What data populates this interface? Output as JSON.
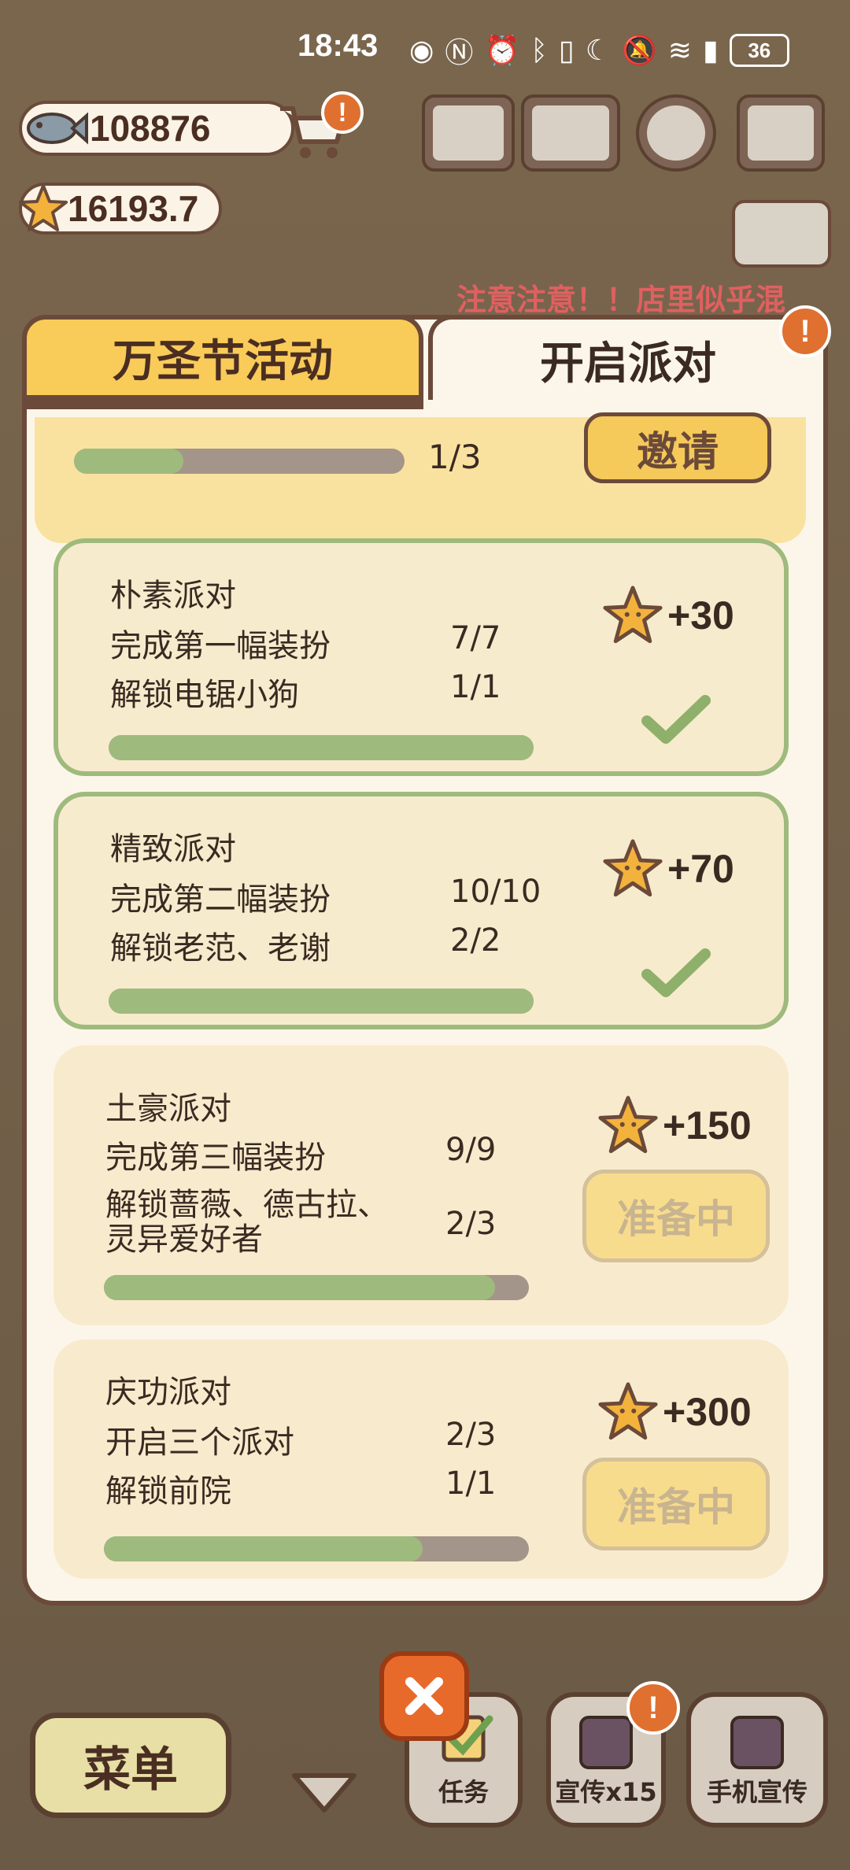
{
  "status": {
    "time": "18:43",
    "icons": [
      "eye-icon",
      "nfc-icon",
      "alarm-icon",
      "bluetooth-icon",
      "vibrate-icon",
      "moon-icon",
      "mute-icon",
      "wifi-icon",
      "signal-icon"
    ],
    "battery": "36"
  },
  "currency": {
    "fish": "108876",
    "stars": "16193.7"
  },
  "notice": "注意注意！！店里似乎混",
  "tabs": {
    "halloween": "万圣节活动",
    "party": "开启派对",
    "badge": "!"
  },
  "top_card": {
    "count": "1/3",
    "progress": 0.33,
    "invite_label": "邀请"
  },
  "parties": [
    {
      "name": "朴素派对",
      "rows": [
        {
          "label": "完成第一幅装扮",
          "count": "7/7"
        },
        {
          "label": "解锁电锯小狗",
          "count": "1/1"
        }
      ],
      "reward": "+30",
      "progress": 1.0,
      "status": "done"
    },
    {
      "name": "精致派对",
      "rows": [
        {
          "label": "完成第二幅装扮",
          "count": "10/10"
        },
        {
          "label": "解锁老范、老谢",
          "count": "2/2"
        }
      ],
      "reward": "+70",
      "progress": 1.0,
      "status": "done"
    },
    {
      "name": "土豪派对",
      "rows": [
        {
          "label": "完成第三幅装扮",
          "count": "9/9"
        },
        {
          "label": "解锁蔷薇、德古拉、",
          "label2": "灵异爱好者",
          "count": "2/3"
        }
      ],
      "reward": "+150",
      "progress": 0.92,
      "status": "preparing",
      "button": "准备中"
    },
    {
      "name": "庆功派对",
      "rows": [
        {
          "label": "开启三个派对",
          "count": "2/3"
        },
        {
          "label": "解锁前院",
          "count": "1/1"
        }
      ],
      "reward": "+300",
      "progress": 0.75,
      "status": "preparing",
      "button": "准备中"
    }
  ],
  "bottom": {
    "menu": "菜单",
    "tasks": "任务",
    "promo": "宣传x15",
    "phone_promo": "手机宣传",
    "badge": "!"
  },
  "colors": {
    "panel": "#fcf6ea",
    "border": "#6b4a3a",
    "tab_active": "#f9cb58",
    "progress_green": "#9fba7d",
    "accent_orange": "#e86a2a"
  }
}
